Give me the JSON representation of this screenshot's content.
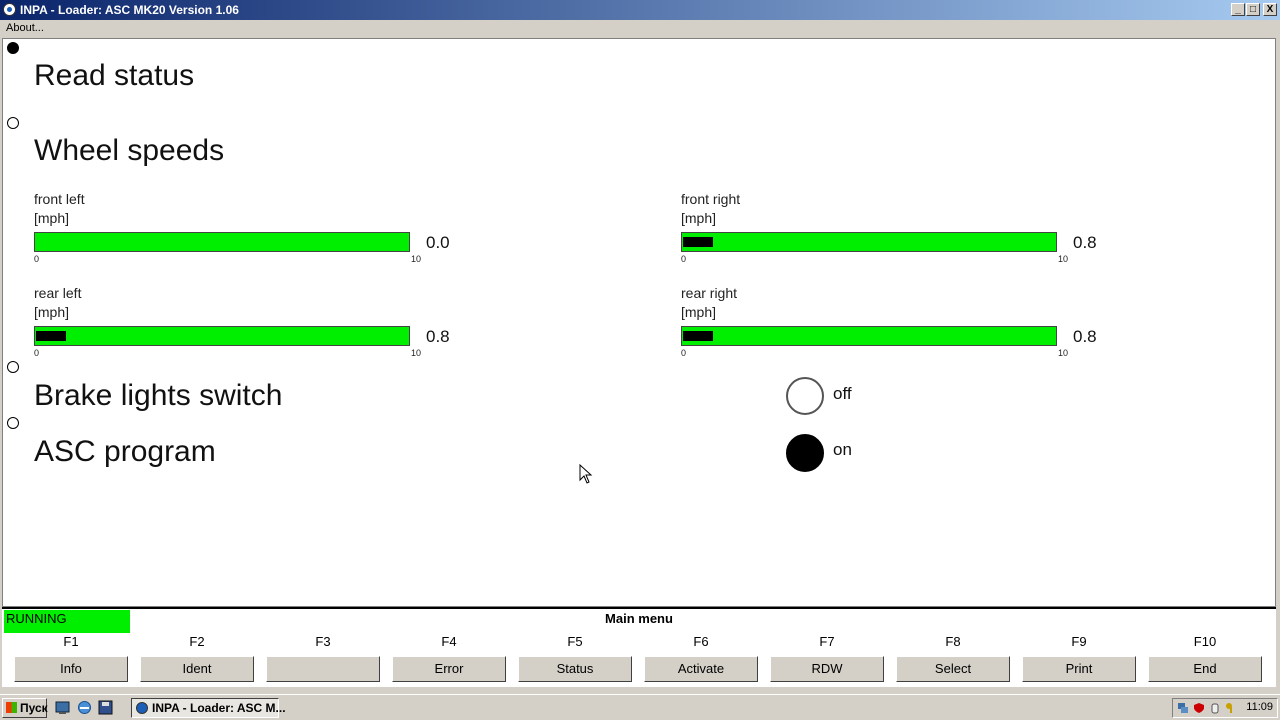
{
  "window": {
    "title": "INPA - Loader:  ASC MK20 Version 1.06",
    "minimize": "_",
    "maximize": "□",
    "close": "X"
  },
  "menubar": {
    "about": "About..."
  },
  "sections": {
    "read_status": "Read status",
    "wheel_speeds": "Wheel speeds",
    "brake_lights": "Brake lights switch",
    "asc_program": "ASC program"
  },
  "wheels": [
    {
      "name": "front left",
      "unit": "[mph]",
      "min": "0",
      "max": "10",
      "value": 0.0,
      "display": "0.0"
    },
    {
      "name": "front right",
      "unit": "[mph]",
      "min": "0",
      "max": "10",
      "value": 0.8,
      "display": "0.8"
    },
    {
      "name": "rear left",
      "unit": "[mph]",
      "min": "0",
      "max": "10",
      "value": 0.8,
      "display": "0.8"
    },
    {
      "name": "rear right",
      "unit": "[mph]",
      "min": "0",
      "max": "10",
      "value": 0.8,
      "display": "0.8"
    }
  ],
  "indicators": {
    "brake_lights": {
      "state": "off"
    },
    "asc_program": {
      "state": "on"
    }
  },
  "status": {
    "running": "RUNNING",
    "menu_title": "Main menu",
    "running_color": "#00ee00"
  },
  "fkeys": [
    {
      "key": "F1",
      "label": "Info"
    },
    {
      "key": "F2",
      "label": "Ident"
    },
    {
      "key": "F3",
      "label": ""
    },
    {
      "key": "F4",
      "label": "Error"
    },
    {
      "key": "F5",
      "label": "Status"
    },
    {
      "key": "F6",
      "label": "Activate"
    },
    {
      "key": "F7",
      "label": "RDW"
    },
    {
      "key": "F8",
      "label": "Select"
    },
    {
      "key": "F9",
      "label": "Print"
    },
    {
      "key": "F10",
      "label": "End"
    }
  ],
  "taskbar": {
    "start": "Пуск",
    "task_label": "INPA - Loader:  ASC M...",
    "clock": "11:09"
  },
  "colors": {
    "bar_green": "#00ee00",
    "titlebar_start": "#0a246a",
    "titlebar_end": "#a6caf0"
  }
}
